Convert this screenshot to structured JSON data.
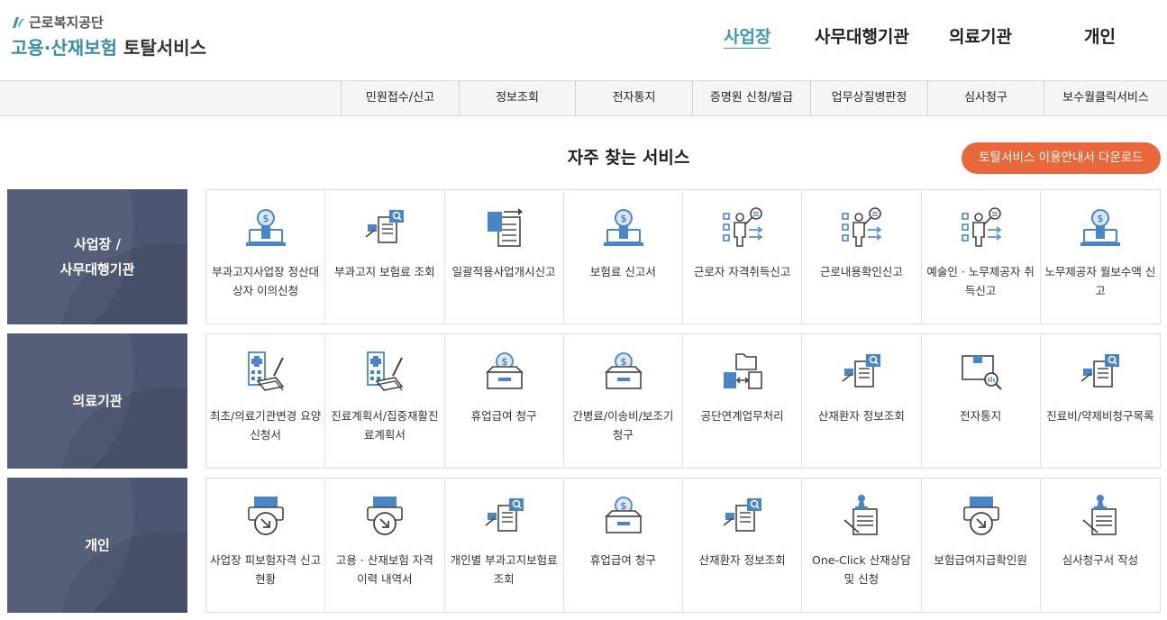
{
  "logo": {
    "org": "근로복지공단",
    "title_teal": "고용·산재보험",
    "title_dark": "토탈서비스"
  },
  "topnav": [
    "사업장",
    "사무대행기관",
    "의료기관",
    "개인"
  ],
  "subnav": [
    "민원접수/신고",
    "정보조회",
    "전자통지",
    "증명원 신청/발급",
    "업무상질병판정",
    "심사청구",
    "보수월클릭서비스"
  ],
  "section_title": "자주 찾는 서비스",
  "download_button": "토탈서비스 이용안내서 다운로드",
  "colors": {
    "accent_teal": "#3f97b0",
    "button_orange": "#e8683c",
    "category_bg": "#4c5572",
    "icon_blue": "#4a86c5"
  },
  "rows": [
    {
      "category": "사업장 /\n사무대행기관",
      "items": [
        {
          "label": "부과고지사업장 정산대상자 이의신청",
          "icon": "money-laptop-icon"
        },
        {
          "label": "부과고지 보험료 조회",
          "icon": "document-search-icon"
        },
        {
          "label": "일괄적용사업개시신고",
          "icon": "document-transfer-icon"
        },
        {
          "label": "보험료 신고서",
          "icon": "money-laptop-icon"
        },
        {
          "label": "근로자 자격취득신고",
          "icon": "presenter-icon"
        },
        {
          "label": "근로내용확인신고",
          "icon": "presenter-icon"
        },
        {
          "label": "예술인 · 노무제공자 취득신고",
          "icon": "presenter-icon"
        },
        {
          "label": "노무제공자 월보수액 신고",
          "icon": "money-laptop-icon"
        }
      ]
    },
    {
      "category": "의료기관",
      "items": [
        {
          "label": "최초/의료기관변경 요양신청서",
          "icon": "hospital-document-icon"
        },
        {
          "label": "진료계획서/집중재활진료계획서",
          "icon": "hospital-document-icon"
        },
        {
          "label": "휴업급여 청구",
          "icon": "coin-box-icon"
        },
        {
          "label": "간병료/이송비/보조기 청구",
          "icon": "coin-box-icon"
        },
        {
          "label": "공단연계업무처리",
          "icon": "folder-exchange-icon"
        },
        {
          "label": "산재환자 정보조회",
          "icon": "document-search-icon"
        },
        {
          "label": "전자통지",
          "icon": "box-search-icon"
        },
        {
          "label": "진료비/약제비청구목록",
          "icon": "document-search-icon"
        }
      ]
    },
    {
      "category": "개인",
      "items": [
        {
          "label": "사업장 피보험자격 신고현황",
          "icon": "printer-arrow-icon"
        },
        {
          "label": "고용 · 산재보험 자격 이력 내역서",
          "icon": "printer-arrow-icon"
        },
        {
          "label": "개인별 부과고지보험료 조회",
          "icon": "document-search-icon"
        },
        {
          "label": "휴업급여 청구",
          "icon": "coin-box-icon"
        },
        {
          "label": "산재환자 정보조회",
          "icon": "document-search-icon"
        },
        {
          "label": "One-Click 산재상담 및 신청",
          "icon": "stamp-document-icon"
        },
        {
          "label": "보험급여지급확인원",
          "icon": "printer-arrow-icon"
        },
        {
          "label": "심사청구서 작성",
          "icon": "stamp-document-icon"
        }
      ]
    }
  ]
}
